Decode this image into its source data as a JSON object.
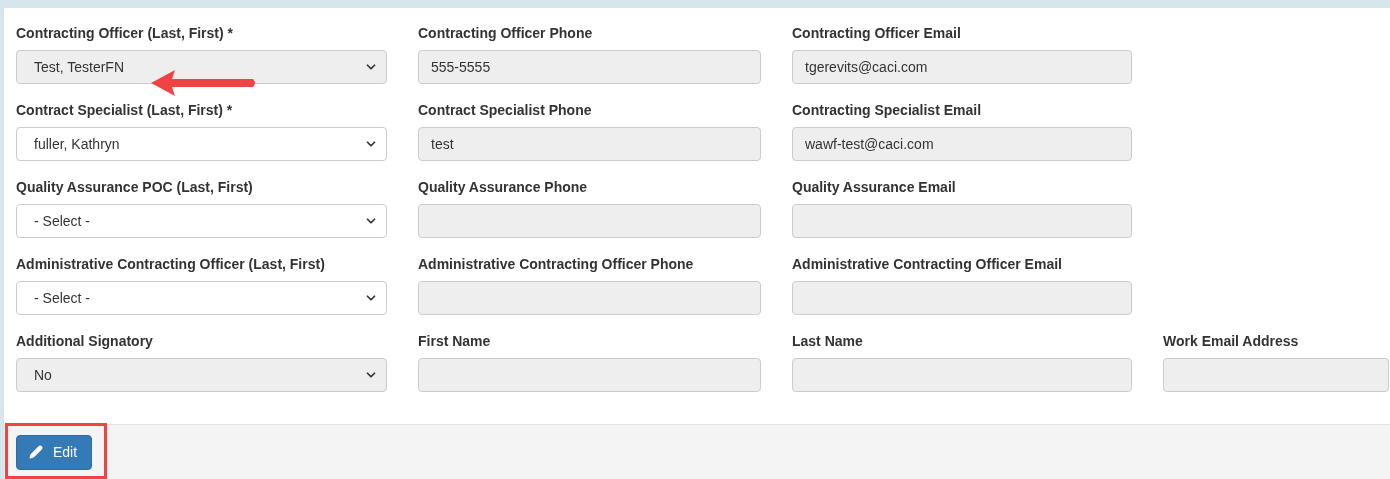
{
  "rows": [
    {
      "fields": [
        {
          "label": "Contracting Officer (Last, First) *",
          "kind": "select",
          "value": "Test, TesterFN",
          "disabled": true,
          "annotated": true
        },
        {
          "label": "Contracting Officer Phone",
          "kind": "input",
          "value": "555-5555"
        },
        {
          "label": "Contracting Officer Email",
          "kind": "input",
          "value": "tgerevits@caci.com"
        }
      ]
    },
    {
      "fields": [
        {
          "label": "Contract Specialist (Last, First) *",
          "kind": "select",
          "value": "fuller, Kathryn",
          "disabled": false
        },
        {
          "label": "Contract Specialist Phone",
          "kind": "input",
          "value": "test"
        },
        {
          "label": "Contracting Specialist Email",
          "kind": "input",
          "value": "wawf-test@caci.com"
        }
      ]
    },
    {
      "fields": [
        {
          "label": "Quality Assurance POC (Last, First)",
          "kind": "select",
          "value": "- Select -",
          "disabled": false
        },
        {
          "label": "Quality Assurance Phone",
          "kind": "input"
        },
        {
          "label": "Quality Assurance Email",
          "kind": "input"
        }
      ]
    },
    {
      "fields": [
        {
          "label": "Administrative Contracting Officer (Last, First)",
          "kind": "select",
          "value": "- Select -",
          "disabled": false
        },
        {
          "label": "Administrative Contracting Officer Phone",
          "kind": "input"
        },
        {
          "label": "Administrative Contracting Officer Email",
          "kind": "input"
        }
      ]
    },
    {
      "fields": [
        {
          "label": "Additional Signatory",
          "kind": "select",
          "value": "No",
          "disabled": true
        },
        {
          "label": "First Name",
          "kind": "input"
        },
        {
          "label": "Last Name",
          "kind": "input"
        },
        {
          "label": "Work Email Address",
          "kind": "input"
        }
      ]
    }
  ],
  "footer": {
    "button": "Edit",
    "highlighted": true
  }
}
